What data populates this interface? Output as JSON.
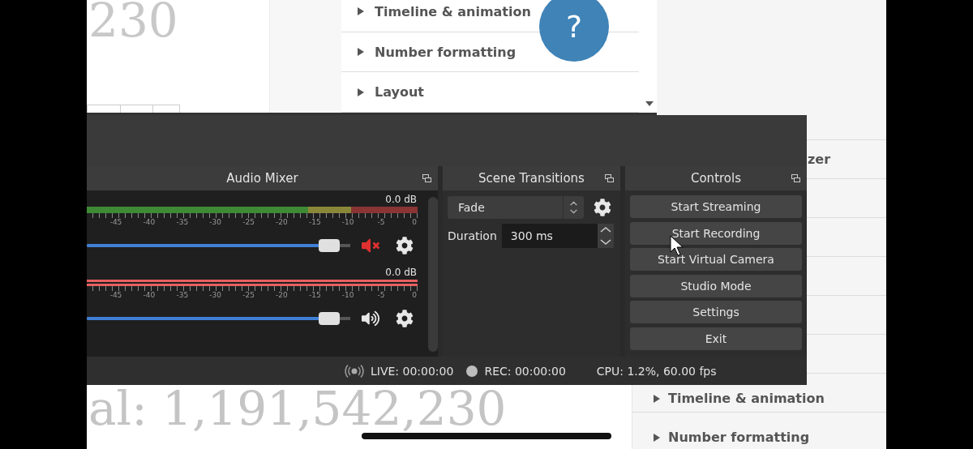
{
  "background_page": {
    "total_text": "al: 1,191,542,230",
    "sidebar_items": [
      {
        "label": "zer"
      },
      {
        "label": "Timeline & animation",
        "expanded": false
      },
      {
        "label": "Number formatting",
        "expanded": false
      }
    ]
  },
  "preview": {
    "big_number": "230",
    "help_button": "?",
    "sections": [
      {
        "label": "Timeline & animation",
        "expanded": false
      },
      {
        "label": "Number formatting",
        "expanded": false
      },
      {
        "label": "Layout",
        "expanded": false
      }
    ]
  },
  "audio_mixer": {
    "title": "Audio Mixer",
    "channels": [
      {
        "reading": "0.0 dB",
        "muted": true,
        "meter": {
          "level": 0
        },
        "volume": {
          "level": 0.96
        },
        "scale": [
          "-45",
          "-40",
          "-35",
          "-30",
          "-25",
          "-20",
          "-15",
          "-10",
          "-5",
          "0"
        ]
      },
      {
        "reading": "0.0 dB",
        "muted": false,
        "meter": {
          "level": 1
        },
        "volume": {
          "level": 0.96
        },
        "scale": [
          "-45",
          "-40",
          "-35",
          "-30",
          "-25",
          "-20",
          "-15",
          "-10",
          "-5",
          "0"
        ]
      }
    ]
  },
  "scene_transitions": {
    "title": "Scene Transitions",
    "transition": "Fade",
    "duration_label": "Duration",
    "duration": "300 ms"
  },
  "controls": {
    "title": "Controls",
    "buttons": [
      "Start Streaming",
      "Start Recording",
      "Start Virtual Camera",
      "Studio Mode",
      "Settings",
      "Exit"
    ]
  },
  "status_bar": {
    "live": "LIVE: 00:00:00",
    "rec": "REC: 00:00:00",
    "cpu": "CPU: 1.2%, 60.00 fps"
  }
}
